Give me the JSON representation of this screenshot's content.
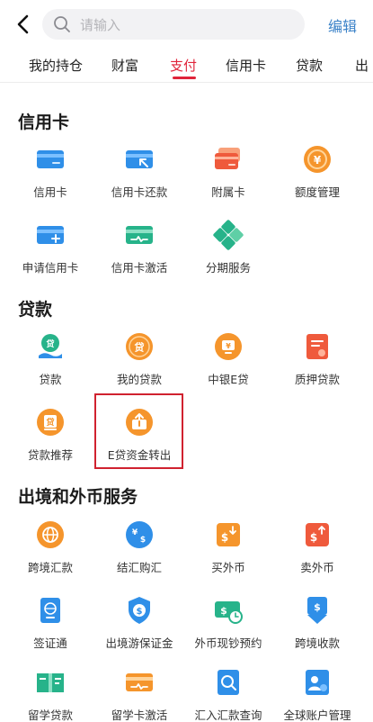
{
  "search": {
    "placeholder": "请输入"
  },
  "header": {
    "edit_label": "编辑"
  },
  "tabs": [
    {
      "label": "我的持仓"
    },
    {
      "label": "财富"
    },
    {
      "label": "支付"
    },
    {
      "label": "信用卡"
    },
    {
      "label": "贷款"
    },
    {
      "label": "出"
    }
  ],
  "active_tab": "支付",
  "sections": {
    "credit_card": {
      "title": "信用卡",
      "items": [
        {
          "label": "信用卡",
          "icon": "credit-card-icon"
        },
        {
          "label": "信用卡还款",
          "icon": "card-repayment-icon"
        },
        {
          "label": "附属卡",
          "icon": "supplementary-card-icon"
        },
        {
          "label": "额度管理",
          "icon": "credit-limit-icon"
        },
        {
          "label": "申请信用卡",
          "icon": "apply-card-icon"
        },
        {
          "label": "信用卡激活",
          "icon": "activate-card-icon"
        },
        {
          "label": "分期服务",
          "icon": "installment-icon"
        }
      ]
    },
    "loan": {
      "title": "贷款",
      "items": [
        {
          "label": "贷款",
          "icon": "loan-icon"
        },
        {
          "label": "我的贷款",
          "icon": "my-loan-icon"
        },
        {
          "label": "中银E贷",
          "icon": "e-loan-icon"
        },
        {
          "label": "质押贷款",
          "icon": "pledge-loan-icon"
        },
        {
          "label": "贷款推荐",
          "icon": "loan-recommend-icon"
        },
        {
          "label": "E贷资金转出",
          "icon": "e-loan-transfer-icon"
        }
      ]
    },
    "cross_border": {
      "title": "出境和外币服务",
      "items": [
        {
          "label": "跨境汇款",
          "icon": "cross-border-remit-icon"
        },
        {
          "label": "结汇购汇",
          "icon": "currency-exchange-icon"
        },
        {
          "label": "买外币",
          "icon": "buy-foreign-currency-icon"
        },
        {
          "label": "卖外币",
          "icon": "sell-foreign-currency-icon"
        },
        {
          "label": "签证通",
          "icon": "visa-icon"
        },
        {
          "label": "出境游保证金",
          "icon": "travel-deposit-icon"
        },
        {
          "label": "外币现钞预约",
          "icon": "cash-reservation-icon"
        },
        {
          "label": "跨境收款",
          "icon": "cross-border-receive-icon"
        },
        {
          "label": "留学贷款",
          "icon": "study-loan-icon"
        },
        {
          "label": "留学卡激活",
          "icon": "study-card-activate-icon"
        },
        {
          "label": "汇入汇款查询",
          "icon": "inward-remit-query-icon"
        },
        {
          "label": "全球账户管理",
          "icon": "global-account-icon"
        }
      ]
    }
  },
  "colors": {
    "accent_red": "#e0243a",
    "link_blue": "#3b82c8",
    "icon_blue": "#2f8fe8",
    "icon_orange": "#f5952c",
    "icon_red": "#ef5a3c",
    "icon_green": "#27b38a"
  }
}
